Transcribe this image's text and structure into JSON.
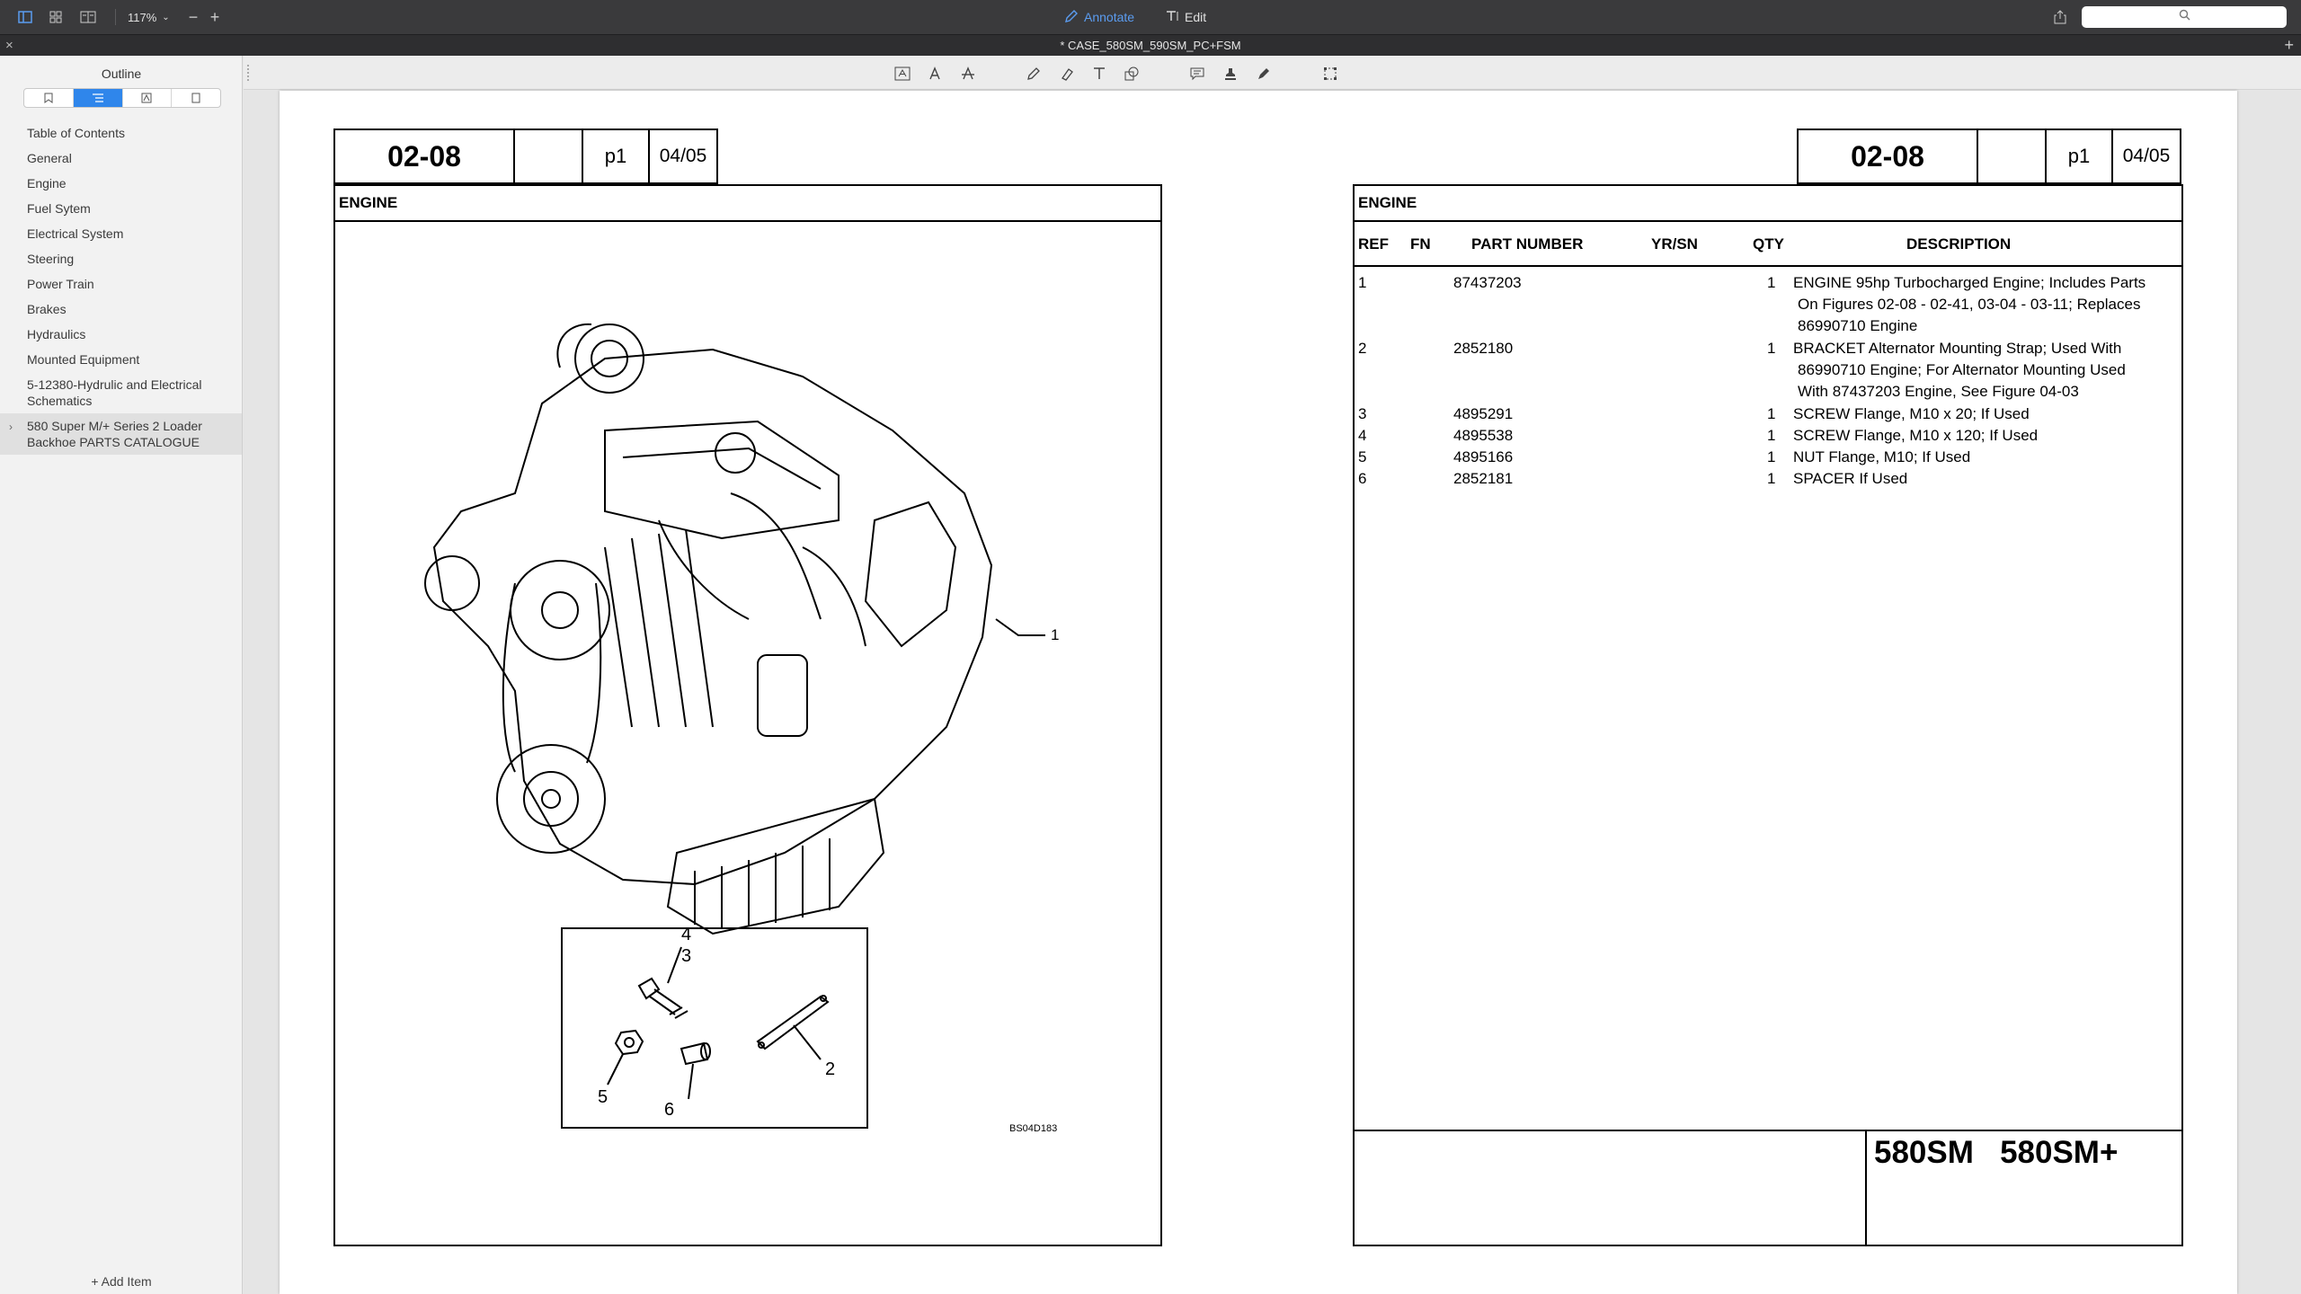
{
  "toolbar": {
    "zoom": "117%",
    "annotate_label": "Annotate",
    "edit_label": "Edit",
    "search_placeholder": ""
  },
  "titlebar": {
    "title": "* CASE_580SM_590SM_PC+FSM"
  },
  "sidebar": {
    "title": "Outline",
    "items": [
      "Table of Contents",
      "General",
      "Engine",
      "Fuel Sytem",
      "Electrical System",
      "Steering",
      "Power Train",
      "Brakes",
      "Hydraulics",
      "Mounted Equipment",
      "5-12380-Hydrulic and Electrical Schematics",
      "580 Super M/+ Series 2 Loader Backhoe PARTS CATALOGUE"
    ],
    "add_item": "+ Add Item"
  },
  "page": {
    "left_header": {
      "code": "02-08",
      "page": "p1",
      "date": "04/05"
    },
    "right_header": {
      "code": "02-08",
      "page": "p1",
      "date": "04/05"
    },
    "left_section": "ENGINE",
    "right_section": "ENGINE",
    "figure_ref": "BS04D183",
    "callouts": {
      "c1": "1",
      "c2": "2",
      "c3": "3",
      "c4": "4",
      "c5": "5",
      "c6": "6"
    },
    "columns": {
      "ref": "REF",
      "fn": "FN",
      "part": "PART NUMBER",
      "yr": "YR/SN",
      "qty": "QTY",
      "desc": "DESCRIPTION"
    },
    "parts": [
      {
        "ref": "1",
        "part": "87437203",
        "qty": "1",
        "desc": "ENGINE 95hp Turbocharged Engine; Includes Parts",
        "desc2": "On Figures 02-08 - 02-41, 03-04 - 03-11; Replaces",
        "desc3": "86990710 Engine"
      },
      {
        "ref": "2",
        "part": "2852180",
        "qty": "1",
        "desc": "BRACKET Alternator Mounting Strap; Used With",
        "desc2": "86990710 Engine; For Alternator Mounting Used",
        "desc3": "With 87437203 Engine, See Figure 04-03"
      },
      {
        "ref": "3",
        "part": "4895291",
        "qty": "1",
        "desc": "SCREW Flange, M10 x 20; If Used"
      },
      {
        "ref": "4",
        "part": "4895538",
        "qty": "1",
        "desc": "SCREW Flange, M10 x 120; If Used"
      },
      {
        "ref": "5",
        "part": "4895166",
        "qty": "1",
        "desc": "NUT Flange, M10; If Used"
      },
      {
        "ref": "6",
        "part": "2852181",
        "qty": "1",
        "desc": "SPACER If Used"
      }
    ],
    "models": "580SM   580SM+"
  },
  "colors": {
    "accent": "#2f86eb",
    "annotate": "#5b9cf0",
    "toolbar": "#3a3a3c"
  }
}
